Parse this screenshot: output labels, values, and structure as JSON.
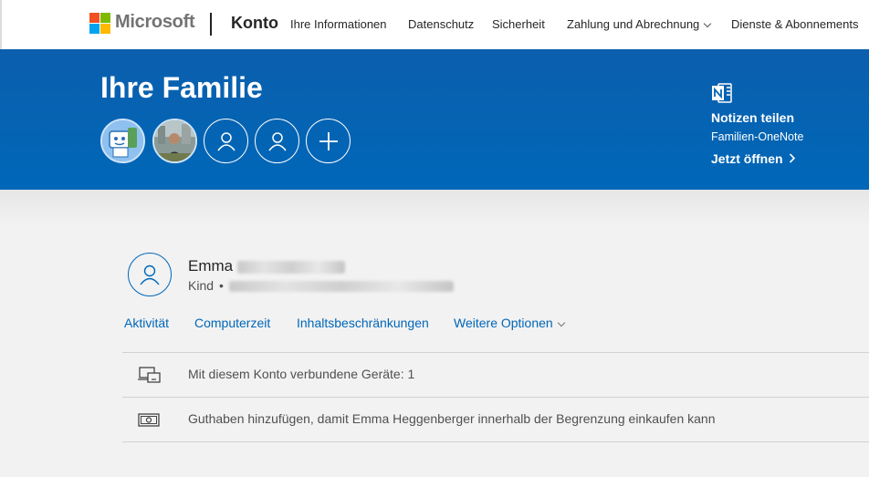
{
  "brand": {
    "name": "Microsoft",
    "product": "Konto"
  },
  "nav": [
    "Ihre Informationen",
    "Datenschutz",
    "Sicherheit",
    "Zahlung und Abrechnung",
    "Dienste & Abonnements"
  ],
  "hero": {
    "title": "Ihre Familie",
    "side_title": "Notizen teilen",
    "side_subtitle": "Familien-OneNote",
    "side_link": "Jetzt öffnen"
  },
  "profile": {
    "first_name": "Emma",
    "role": "Kind"
  },
  "tabs": [
    "Aktivität",
    "Computerzeit",
    "Inhaltsbeschränkungen",
    "Weitere Optionen"
  ],
  "info": [
    {
      "icon": "devices-icon",
      "text": "Mit diesem Konto verbundene Geräte: 1"
    },
    {
      "icon": "money-icon",
      "text": "Guthaben hinzufügen, damit Emma Heggenberger innerhalb der Begrenzung einkaufen kann"
    }
  ],
  "colors": {
    "accent": "#0067b8",
    "hero_bg": "#0067b8",
    "page_bg": "#f2f2f2"
  }
}
